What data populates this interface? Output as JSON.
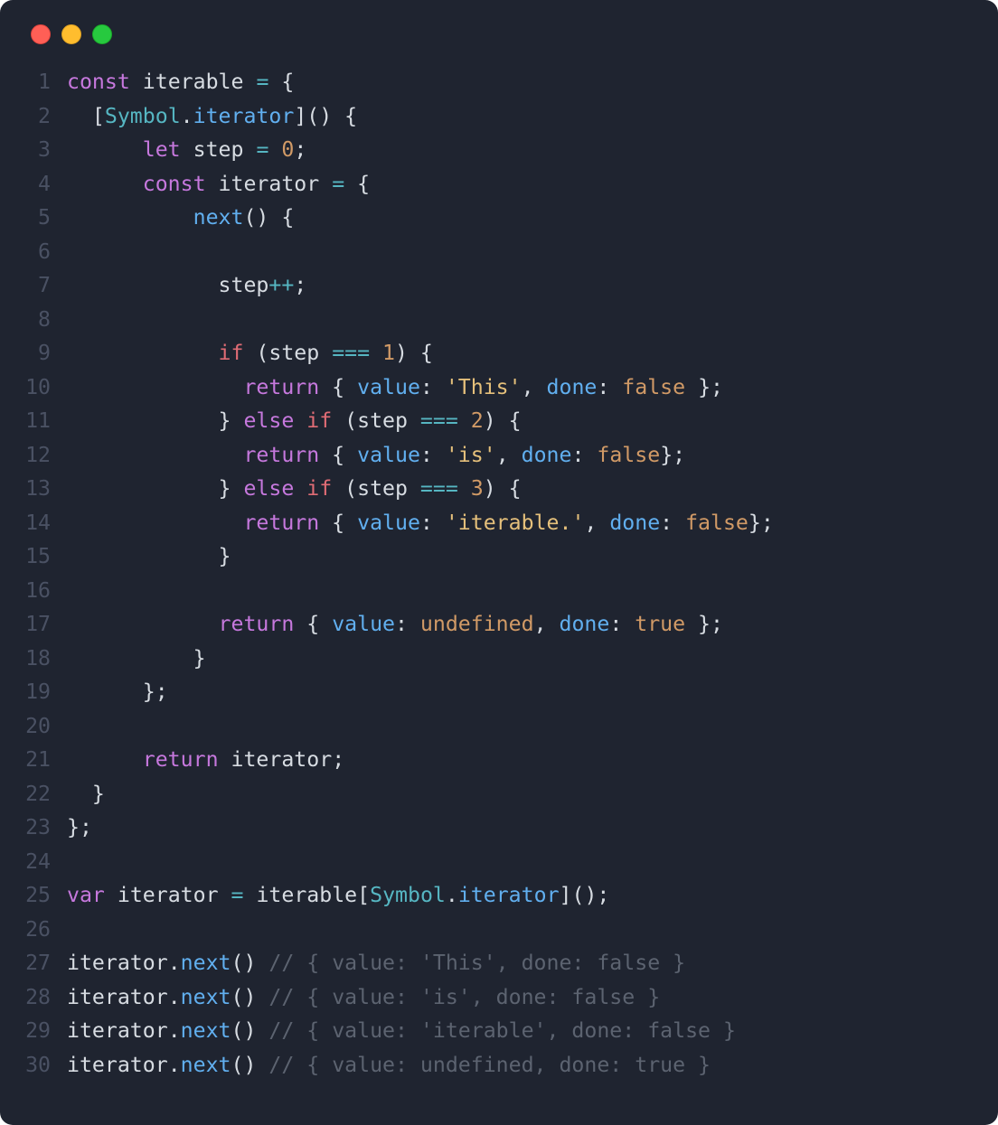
{
  "window_controls": [
    "close",
    "minimize",
    "zoom"
  ],
  "colors": {
    "background": "#1f2430",
    "gutter": "#4a5163",
    "keyword": "#c678dd",
    "if": "#e06c75",
    "type": "#56b6c2",
    "function": "#61afef",
    "operator": "#56b6c2",
    "number": "#d19a66",
    "string": "#e5c07b",
    "boolean": "#d19a66",
    "comment": "#5c6370",
    "default": "#d7dce2"
  },
  "code_lines": [
    {
      "n": 1,
      "tokens": [
        [
          "kw",
          "const"
        ],
        [
          "pun",
          " "
        ],
        [
          "id",
          "iterable"
        ],
        [
          "pun",
          " "
        ],
        [
          "op",
          "="
        ],
        [
          "pun",
          " {"
        ]
      ]
    },
    {
      "n": 2,
      "tokens": [
        [
          "pun",
          "  ["
        ],
        [
          "sym",
          "Symbol"
        ],
        [
          "pun",
          "."
        ],
        [
          "fn",
          "iterator"
        ],
        [
          "pun",
          "]() {"
        ]
      ]
    },
    {
      "n": 3,
      "tokens": [
        [
          "pun",
          "      "
        ],
        [
          "kw",
          "let"
        ],
        [
          "pun",
          " "
        ],
        [
          "id",
          "step"
        ],
        [
          "pun",
          " "
        ],
        [
          "op",
          "="
        ],
        [
          "pun",
          " "
        ],
        [
          "num",
          "0"
        ],
        [
          "pun",
          ";"
        ]
      ]
    },
    {
      "n": 4,
      "tokens": [
        [
          "pun",
          "      "
        ],
        [
          "kw",
          "const"
        ],
        [
          "pun",
          " "
        ],
        [
          "id",
          "iterator"
        ],
        [
          "pun",
          " "
        ],
        [
          "op",
          "="
        ],
        [
          "pun",
          " {"
        ]
      ]
    },
    {
      "n": 5,
      "tokens": [
        [
          "pun",
          "          "
        ],
        [
          "fn",
          "next"
        ],
        [
          "pun",
          "() {"
        ]
      ]
    },
    {
      "n": 6,
      "tokens": []
    },
    {
      "n": 7,
      "tokens": [
        [
          "pun",
          "            "
        ],
        [
          "id",
          "step"
        ],
        [
          "op",
          "++"
        ],
        [
          "pun",
          ";"
        ]
      ]
    },
    {
      "n": 8,
      "tokens": []
    },
    {
      "n": 9,
      "tokens": [
        [
          "pun",
          "            "
        ],
        [
          "if",
          "if"
        ],
        [
          "pun",
          " ("
        ],
        [
          "id",
          "step"
        ],
        [
          "pun",
          " "
        ],
        [
          "op",
          "==="
        ],
        [
          "pun",
          " "
        ],
        [
          "num",
          "1"
        ],
        [
          "pun",
          ") {"
        ]
      ]
    },
    {
      "n": 10,
      "tokens": [
        [
          "pun",
          "              "
        ],
        [
          "kw",
          "return"
        ],
        [
          "pun",
          " { "
        ],
        [
          "prop",
          "value"
        ],
        [
          "pun",
          ": "
        ],
        [
          "str",
          "'This'"
        ],
        [
          "pun",
          ", "
        ],
        [
          "prop",
          "done"
        ],
        [
          "pun",
          ": "
        ],
        [
          "bool",
          "false"
        ],
        [
          "pun",
          " };"
        ]
      ]
    },
    {
      "n": 11,
      "tokens": [
        [
          "pun",
          "            } "
        ],
        [
          "kw",
          "else"
        ],
        [
          "pun",
          " "
        ],
        [
          "if",
          "if"
        ],
        [
          "pun",
          " ("
        ],
        [
          "id",
          "step"
        ],
        [
          "pun",
          " "
        ],
        [
          "op",
          "==="
        ],
        [
          "pun",
          " "
        ],
        [
          "num",
          "2"
        ],
        [
          "pun",
          ") {"
        ]
      ]
    },
    {
      "n": 12,
      "tokens": [
        [
          "pun",
          "              "
        ],
        [
          "kw",
          "return"
        ],
        [
          "pun",
          " { "
        ],
        [
          "prop",
          "value"
        ],
        [
          "pun",
          ": "
        ],
        [
          "str",
          "'is'"
        ],
        [
          "pun",
          ", "
        ],
        [
          "prop",
          "done"
        ],
        [
          "pun",
          ": "
        ],
        [
          "bool",
          "false"
        ],
        [
          "pun",
          "};"
        ]
      ]
    },
    {
      "n": 13,
      "tokens": [
        [
          "pun",
          "            } "
        ],
        [
          "kw",
          "else"
        ],
        [
          "pun",
          " "
        ],
        [
          "if",
          "if"
        ],
        [
          "pun",
          " ("
        ],
        [
          "id",
          "step"
        ],
        [
          "pun",
          " "
        ],
        [
          "op",
          "==="
        ],
        [
          "pun",
          " "
        ],
        [
          "num",
          "3"
        ],
        [
          "pun",
          ") {"
        ]
      ]
    },
    {
      "n": 14,
      "tokens": [
        [
          "pun",
          "              "
        ],
        [
          "kw",
          "return"
        ],
        [
          "pun",
          " { "
        ],
        [
          "prop",
          "value"
        ],
        [
          "pun",
          ": "
        ],
        [
          "str",
          "'iterable.'"
        ],
        [
          "pun",
          ", "
        ],
        [
          "prop",
          "done"
        ],
        [
          "pun",
          ": "
        ],
        [
          "bool",
          "false"
        ],
        [
          "pun",
          "};"
        ]
      ]
    },
    {
      "n": 15,
      "tokens": [
        [
          "pun",
          "            }"
        ]
      ]
    },
    {
      "n": 16,
      "tokens": []
    },
    {
      "n": 17,
      "tokens": [
        [
          "pun",
          "            "
        ],
        [
          "kw",
          "return"
        ],
        [
          "pun",
          " { "
        ],
        [
          "prop",
          "value"
        ],
        [
          "pun",
          ": "
        ],
        [
          "undef",
          "undefined"
        ],
        [
          "pun",
          ", "
        ],
        [
          "prop",
          "done"
        ],
        [
          "pun",
          ": "
        ],
        [
          "bool",
          "true"
        ],
        [
          "pun",
          " };"
        ]
      ]
    },
    {
      "n": 18,
      "tokens": [
        [
          "pun",
          "          }"
        ]
      ]
    },
    {
      "n": 19,
      "tokens": [
        [
          "pun",
          "      };"
        ]
      ]
    },
    {
      "n": 20,
      "tokens": []
    },
    {
      "n": 21,
      "tokens": [
        [
          "pun",
          "      "
        ],
        [
          "kw",
          "return"
        ],
        [
          "pun",
          " "
        ],
        [
          "id",
          "iterator"
        ],
        [
          "pun",
          ";"
        ]
      ]
    },
    {
      "n": 22,
      "tokens": [
        [
          "pun",
          "  }"
        ]
      ]
    },
    {
      "n": 23,
      "tokens": [
        [
          "pun",
          "};"
        ]
      ]
    },
    {
      "n": 24,
      "tokens": []
    },
    {
      "n": 25,
      "tokens": [
        [
          "kw",
          "var"
        ],
        [
          "pun",
          " "
        ],
        [
          "id",
          "iterator"
        ],
        [
          "pun",
          " "
        ],
        [
          "op",
          "="
        ],
        [
          "pun",
          " "
        ],
        [
          "id",
          "iterable"
        ],
        [
          "pun",
          "["
        ],
        [
          "sym",
          "Symbol"
        ],
        [
          "pun",
          "."
        ],
        [
          "fn",
          "iterator"
        ],
        [
          "pun",
          "]();"
        ]
      ]
    },
    {
      "n": 26,
      "tokens": []
    },
    {
      "n": 27,
      "tokens": [
        [
          "id",
          "iterator"
        ],
        [
          "pun",
          "."
        ],
        [
          "fn",
          "next"
        ],
        [
          "pun",
          "() "
        ],
        [
          "cmt",
          "// { value: 'This', done: false }"
        ]
      ]
    },
    {
      "n": 28,
      "tokens": [
        [
          "id",
          "iterator"
        ],
        [
          "pun",
          "."
        ],
        [
          "fn",
          "next"
        ],
        [
          "pun",
          "() "
        ],
        [
          "cmt",
          "// { value: 'is', done: false }"
        ]
      ]
    },
    {
      "n": 29,
      "tokens": [
        [
          "id",
          "iterator"
        ],
        [
          "pun",
          "."
        ],
        [
          "fn",
          "next"
        ],
        [
          "pun",
          "() "
        ],
        [
          "cmt",
          "// { value: 'iterable', done: false }"
        ]
      ]
    },
    {
      "n": 30,
      "tokens": [
        [
          "id",
          "iterator"
        ],
        [
          "pun",
          "."
        ],
        [
          "fn",
          "next"
        ],
        [
          "pun",
          "() "
        ],
        [
          "cmt",
          "// { value: undefined, done: true }"
        ]
      ]
    }
  ]
}
